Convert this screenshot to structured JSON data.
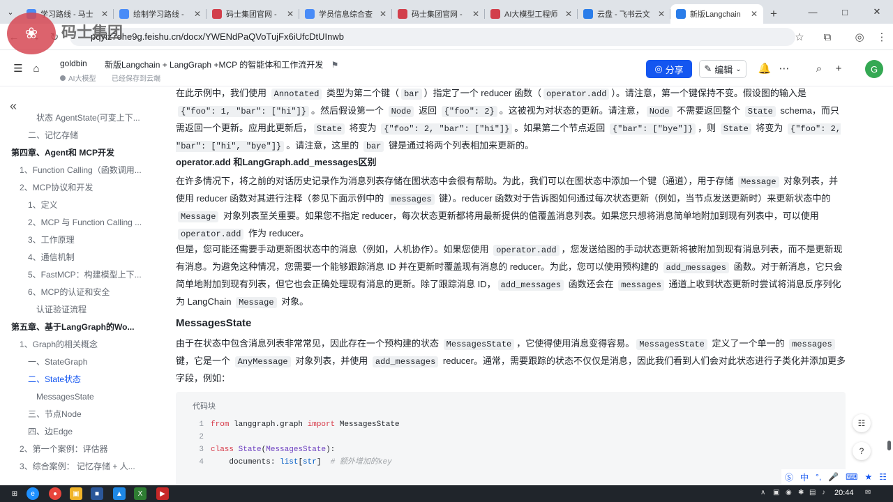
{
  "browser": {
    "tabs": [
      {
        "title": "学习路线 - 马士",
        "fav_color": "#4a8cf7",
        "active": false
      },
      {
        "title": "绘制学习路线 -",
        "fav_color": "#4a8cf7",
        "active": false
      },
      {
        "title": "码士集团官网 -",
        "fav_color": "#d23f4b",
        "active": false
      },
      {
        "title": "学员信息综合查",
        "fav_color": "#4a8cf7",
        "active": false
      },
      {
        "title": "码士集团官网 -",
        "fav_color": "#d23f4b",
        "active": false
      },
      {
        "title": "AI大模型工程师",
        "fav_color": "#d23f4b",
        "active": false
      },
      {
        "title": "云盘 - 飞书云文",
        "fav_color": "#2b7de9",
        "active": false
      },
      {
        "title": "新版Langchain",
        "fav_color": "#2b7de9",
        "active": true
      }
    ],
    "url": "pqyiz7ohe9g.feishu.cn/docx/YWENdPaQVoTujFx6iUfcDtUInwb",
    "watermark_text": "码士集团"
  },
  "doc_header": {
    "space_name": "goldbin",
    "space_tag": "AI大模型",
    "title": "新版Langchain + LangGraph +MCP 的智能体和工作流开发",
    "save_status": "已经保存到云端",
    "share_label": "分享",
    "edit_label": "编辑",
    "avatar_letter": "G"
  },
  "toc": [
    {
      "label": "状态 AgentState(可变上下...",
      "level": 3,
      "style": "normal"
    },
    {
      "label": "二、记忆存储",
      "level": 2,
      "style": "normal"
    },
    {
      "label": "第四章、Agent和 MCP开发",
      "level": 0,
      "style": "chapter"
    },
    {
      "label": "1、Function Calling（函数调用...",
      "level": 1,
      "style": "normal"
    },
    {
      "label": "2、MCP协议和开发",
      "level": 1,
      "style": "normal"
    },
    {
      "label": "1、定义",
      "level": 2,
      "style": "normal"
    },
    {
      "label": "2、MCP 与 Function Calling ...",
      "level": 2,
      "style": "normal"
    },
    {
      "label": "3、工作原理",
      "level": 2,
      "style": "normal"
    },
    {
      "label": "4、通信机制",
      "level": 2,
      "style": "normal"
    },
    {
      "label": "5、FastMCP：构建模型上下...",
      "level": 2,
      "style": "normal"
    },
    {
      "label": "6、MCP的认证和安全",
      "level": 2,
      "style": "normal"
    },
    {
      "label": "认证验证流程",
      "level": 3,
      "style": "normal"
    },
    {
      "label": "第五章、基于LangGraph的Wo...",
      "level": 0,
      "style": "chapter"
    },
    {
      "label": "1、Graph的相关概念",
      "level": 1,
      "style": "normal"
    },
    {
      "label": "一、StateGraph",
      "level": 2,
      "style": "normal"
    },
    {
      "label": "二、State状态",
      "level": 2,
      "style": "active"
    },
    {
      "label": "MessagesState",
      "level": 3,
      "style": "normal"
    },
    {
      "label": "三、节点Node",
      "level": 2,
      "style": "normal"
    },
    {
      "label": "四、边Edge",
      "level": 2,
      "style": "normal"
    },
    {
      "label": "2、第一个案例：评估器",
      "level": 1,
      "style": "normal"
    },
    {
      "label": "3、综合案例： 记忆存储 + 人...",
      "level": 1,
      "style": "normal"
    }
  ],
  "content": {
    "p1": [
      {
        "t": "在此示例中，我们使用 "
      },
      {
        "c": "Annotated"
      },
      {
        "t": " 类型为第二个键（"
      },
      {
        "c": "bar"
      },
      {
        "t": "）指定了一个 reducer 函数（"
      },
      {
        "c": "operator.add"
      },
      {
        "t": "）。请注意，第一个键保持不变。假设图的输入是 "
      },
      {
        "c": "{\"foo\": 1, \"bar\": [\"hi\"]}"
      },
      {
        "t": "。然后假设第一个 "
      },
      {
        "c": "Node"
      },
      {
        "t": " 返回 "
      },
      {
        "c": "{\"foo\": 2}"
      },
      {
        "t": "。这被视为对状态的更新。请注意，"
      },
      {
        "c": "Node"
      },
      {
        "t": " 不需要返回整个 "
      },
      {
        "c": "State"
      },
      {
        "t": " schema，而只需返回一个更新。应用此更新后，"
      },
      {
        "c": "State"
      },
      {
        "t": " 将变为 "
      },
      {
        "c": "{\"foo\": 2, \"bar\": [\"hi\"]}"
      },
      {
        "t": "。如果第二个节点返回 "
      },
      {
        "c": "{\"bar\": [\"bye\"]}"
      },
      {
        "t": "，则 "
      },
      {
        "c": "State"
      },
      {
        "t": " 将变为 "
      },
      {
        "c": "{\"foo\": 2, \"bar\": [\"hi\", \"bye\"]}"
      },
      {
        "t": "。请注意，这里的 "
      },
      {
        "c": "bar"
      },
      {
        "t": " 键是通过将两个列表相加来更新的。"
      }
    ],
    "h1": "operator.add 和LangGraph.add_messages区别",
    "p2": [
      {
        "t": "在许多情况下，将之前的对话历史记录作为消息列表存储在图状态中会很有帮助。为此，我们可以在图状态中添加一个键（通道），用于存储 "
      },
      {
        "c": "Message"
      },
      {
        "t": " 对象列表，并使用 reducer 函数对其进行注释（参见下面示例中的 "
      },
      {
        "c": "messages"
      },
      {
        "t": " 键）。reducer 函数对于告诉图如何通过每次状态更新（例如，当节点发送更新时）来更新状态中的 "
      },
      {
        "c": "Message"
      },
      {
        "t": " 对象列表至关重要。如果您不指定 reducer，每次状态更新都将用最新提供的值覆盖消息列表。如果您只想将消息简单地附加到现有列表中，可以使用 "
      },
      {
        "c": "operator.add"
      },
      {
        "t": " 作为 reducer。"
      }
    ],
    "p3": [
      {
        "t": "但是，您可能还需要手动更新图状态中的消息（例如，人机协作）。如果您使用 "
      },
      {
        "c": "operator.add"
      },
      {
        "t": "，您发送给图的手动状态更新将被附加到现有消息列表，而不是更新现有消息。为避免这种情况，您需要一个能够跟踪消息 ID 并在更新时覆盖现有消息的 reducer。为此，您可以使用预构建的 "
      },
      {
        "c": "add_messages"
      },
      {
        "t": " 函数。对于新消息，它只会简单地附加到现有列表，但它也会正确处理现有消息的更新。除了跟踪消息 ID，"
      },
      {
        "c": "add_messages"
      },
      {
        "t": " 函数还会在 "
      },
      {
        "c": "messages"
      },
      {
        "t": " 通道上收到状态更新时尝试将消息反序列化为 LangChain "
      },
      {
        "c": "Message"
      },
      {
        "t": " 对象。"
      }
    ],
    "h2": "MessagesState",
    "p4": [
      {
        "t": "由于在状态中包含消息列表非常常见，因此存在一个预构建的状态 "
      },
      {
        "c": "MessagesState"
      },
      {
        "t": "，它使得使用消息变得容易。"
      },
      {
        "c": "MessagesState"
      },
      {
        "t": " 定义了一个单一的 "
      },
      {
        "c": "messages"
      },
      {
        "t": " 键，它是一个 "
      },
      {
        "c": "AnyMessage"
      },
      {
        "t": " 对象列表，并使用 "
      },
      {
        "c": "add_messages"
      },
      {
        "t": " reducer。通常，需要跟踪的状态不仅仅是消息，因此我们看到人们会对此状态进行子类化并添加更多字段，例如："
      }
    ],
    "code_label": "代码块",
    "code_lines": [
      {
        "n": "1",
        "parts": [
          {
            "k": "kw",
            "v": "from"
          },
          {
            "k": "",
            "v": " langgraph.graph "
          },
          {
            "k": "kw",
            "v": "import"
          },
          {
            "k": "",
            "v": " MessagesState"
          }
        ]
      },
      {
        "n": "2",
        "parts": []
      },
      {
        "n": "3",
        "parts": [
          {
            "k": "kw",
            "v": "class"
          },
          {
            "k": "",
            "v": " "
          },
          {
            "k": "cls",
            "v": "State"
          },
          {
            "k": "",
            "v": "("
          },
          {
            "k": "cls",
            "v": "MessagesState"
          },
          {
            "k": "",
            "v": "):"
          }
        ]
      },
      {
        "n": "4",
        "parts": [
          {
            "k": "",
            "v": "    documents: "
          },
          {
            "k": "bi",
            "v": "list"
          },
          {
            "k": "",
            "v": "["
          },
          {
            "k": "bi",
            "v": "str"
          },
          {
            "k": "",
            "v": "]  "
          },
          {
            "k": "cm",
            "v": "# 额外增加的key"
          }
        ]
      }
    ]
  },
  "taskbar": {
    "clock": "20:44"
  },
  "ime": {
    "mode": "中"
  }
}
